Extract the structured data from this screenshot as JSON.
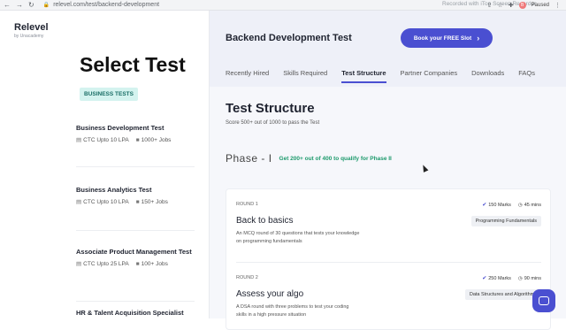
{
  "browser": {
    "back": "←",
    "forward": "→",
    "reload": "↻",
    "url": "relevel.com/test/backend-development",
    "recording_note": "Recorded with iTop Screen Recorder",
    "profile_initial": "B",
    "paused_label": "Paused"
  },
  "brand": {
    "name": "Relevel",
    "sub": "by Unacademy"
  },
  "sidebar": {
    "title": "Select Test",
    "category": "BUSINESS TESTS",
    "tests": [
      {
        "title": "Business Development Test",
        "ctc": "CTC Upto 10 LPA",
        "jobs": "1000+ Jobs"
      },
      {
        "title": "Business Analytics Test",
        "ctc": "CTC Upto 10 LPA",
        "jobs": "150+ Jobs"
      },
      {
        "title": "Associate Product Management Test",
        "ctc": "CTC Upto 25 LPA",
        "jobs": "100+ Jobs"
      },
      {
        "title": "HR & Talent Acquisition Specialist",
        "ctc": "",
        "jobs": ""
      }
    ]
  },
  "header": {
    "title": "Backend Development Test",
    "cta": "Book your FREE Slot",
    "tabs": [
      "Recently Hired",
      "Skills Required",
      "Test Structure",
      "Partner Companies",
      "Downloads",
      "FAQs"
    ],
    "active_tab": "Test Structure"
  },
  "structure": {
    "title": "Test Structure",
    "subtitle": "Score 500+ out of 1000 to pass the Test",
    "phase_label": "Phase - I",
    "phase_qualify": "Get 200+ out of 400 to qualify for Phase II",
    "rounds": [
      {
        "number": "ROUND 1",
        "name": "Back to basics",
        "description": "An MCQ round of 30 questions that tests your knowledge on programming fundamentals",
        "marks": "150 Marks",
        "duration": "45 mins",
        "tag": "Programming Fundamentals"
      },
      {
        "number": "ROUND 2",
        "name": "Assess your algo",
        "description": "A DSA round with three problems to test your coding skills in a high pressure situation",
        "marks": "250 Marks",
        "duration": "90 mins",
        "tag": "Data Structures and Algorithms"
      }
    ]
  },
  "colors": {
    "accent": "#4a4fd1",
    "badge_bg": "#d4f3ef",
    "qualify": "#1d9a6c"
  }
}
